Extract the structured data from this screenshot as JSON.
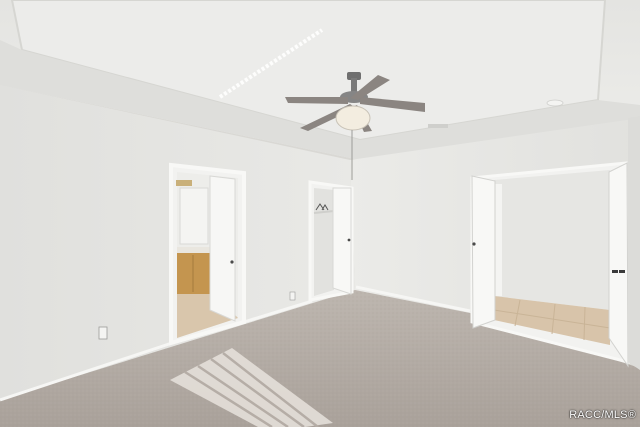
{
  "watermark": "RACC/MLS®",
  "scene": {
    "wall_color": "#e6e6e3",
    "ceiling_color": "#e9e9e6",
    "carpet_color": "#b4aca5",
    "door_color": "#f7f7f5",
    "tile_color": "#d8c4aa",
    "cabinet_color": "#c4954f"
  }
}
